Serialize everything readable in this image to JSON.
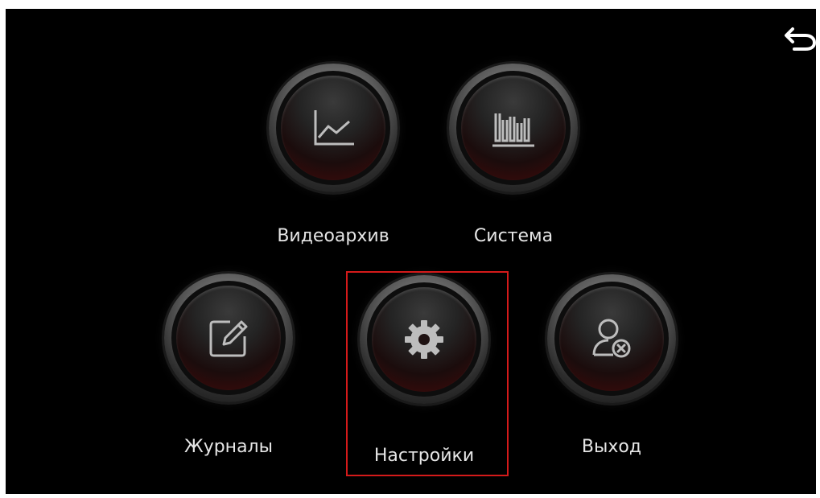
{
  "header": {
    "back_icon": "back-arrow-icon"
  },
  "menu": {
    "items": [
      {
        "id": "video-archive",
        "label": "Видеоархив",
        "icon": "line-chart-icon",
        "selected": false
      },
      {
        "id": "system",
        "label": "Система",
        "icon": "bar-chart-icon",
        "selected": false
      },
      {
        "id": "logs",
        "label": "Журналы",
        "icon": "edit-icon",
        "selected": false
      },
      {
        "id": "settings",
        "label": "Настройки",
        "icon": "gear-icon",
        "selected": true
      },
      {
        "id": "exit",
        "label": "Выход",
        "icon": "user-logout-icon",
        "selected": false
      }
    ]
  },
  "colors": {
    "background": "#000000",
    "label": "#e6e6e6",
    "selection": "#d41a1a",
    "icon": "#bdbdbd"
  }
}
